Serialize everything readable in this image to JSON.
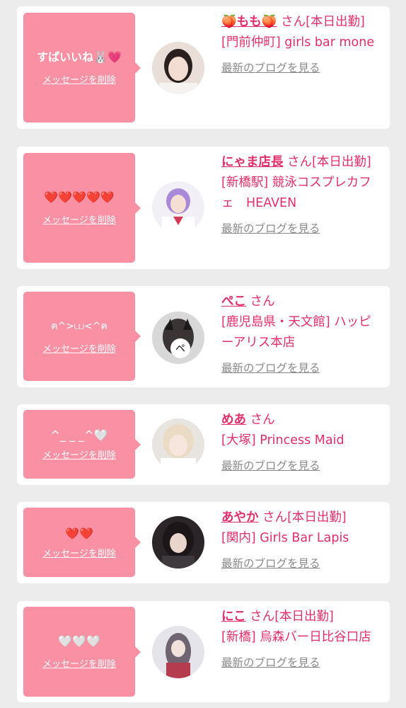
{
  "delete_label": "メッセージを削除",
  "blog_label": "最新のブログを見る",
  "colors": {
    "accent": "#e0306a",
    "bubble": "#f990a4",
    "link_gray": "#8a8a8a",
    "background": "#ececec"
  },
  "messages": [
    {
      "text": "すぱいいね🐰💗",
      "name": "🍑もも🍑",
      "suffix": "さん[本日出勤]",
      "shop": "[門前仲町] girls bar mone",
      "avatar_color": "#d9c2b8"
    },
    {
      "text": "❤️❤️❤️❤️❤️",
      "name": "にゃま店長",
      "suffix": "さん[本日出勤]",
      "shop": "[新橋駅] 競泳コスプレカフェ　HEAVEN",
      "avatar_color": "#8b6fc4"
    },
    {
      "text": "ฅ^>⩊<^ฅ",
      "name": "ぺこ",
      "suffix": "さん",
      "shop": "[鹿児島県・天文館] ハッピーアリス本店",
      "avatar_color": "#bbbbbb"
    },
    {
      "text": "^_ _ _^🤍",
      "name": "めあ",
      "suffix": "さん",
      "shop": "[大塚] Princess Maid",
      "avatar_color": "#e6d3bf"
    },
    {
      "text": "❤️❤️",
      "name": "あやか",
      "suffix": "さん[本日出勤]",
      "shop": "[関内] Girls Bar Lapis",
      "avatar_color": "#3a3038"
    },
    {
      "text": "🤍🤍🤍",
      "name": "にこ",
      "suffix": "さん[本日出勤]",
      "shop": "[新橋] 烏森バー日比谷口店",
      "avatar_color": "#cfcfd6"
    }
  ]
}
